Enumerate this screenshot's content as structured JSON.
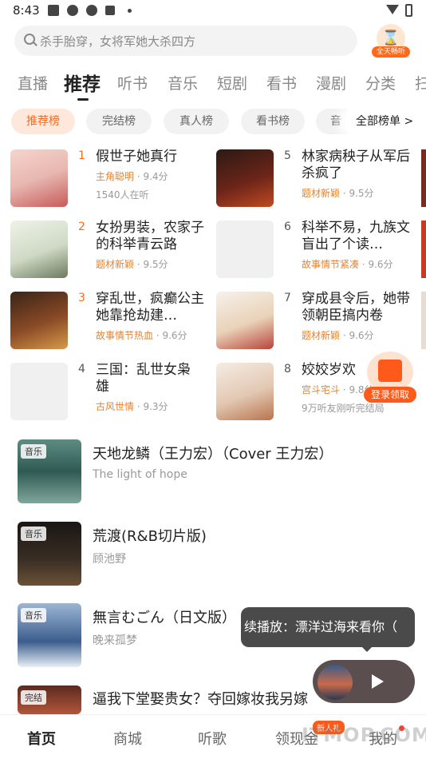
{
  "status_bar": {
    "time": "8:43"
  },
  "search": {
    "placeholder": "杀手胎穿，女将军她大杀四方"
  },
  "promo": {
    "label": "全天畅听"
  },
  "tabs": [
    "直播",
    "推荐",
    "听书",
    "音乐",
    "短剧",
    "看书",
    "漫剧",
    "分类",
    "扫"
  ],
  "active_tab": "推荐",
  "chips": [
    "推荐榜",
    "完结榜",
    "真人榜",
    "看书榜",
    "音"
  ],
  "all_rankings": "全部榜单 >",
  "books": [
    {
      "rank": "1",
      "title": "假世子她真行",
      "tag": "主角聪明",
      "score": "· 9.4分",
      "sub": "1540人在听"
    },
    {
      "rank": "2",
      "title": "女扮男装，农家子的科举青云路",
      "tag": "题材新颖",
      "score": "· 9.5分",
      "sub": ""
    },
    {
      "rank": "3",
      "title": "穿乱世，疯癫公主她靠抢劫建…",
      "tag": "故事情节热血",
      "score": "· 9.6分",
      "sub": ""
    },
    {
      "rank": "4",
      "title": "三国：乱世女枭雄",
      "tag": "古风世情",
      "score": "· 9.3分",
      "sub": ""
    },
    {
      "rank": "5",
      "title": "林家病秧子从军后杀疯了",
      "tag": "题材新颖",
      "score": "· 9.5分",
      "sub": ""
    },
    {
      "rank": "6",
      "title": "科举不易，九族文盲出了个读…",
      "tag": "故事情节紧凑",
      "score": "· 9.6分",
      "sub": ""
    },
    {
      "rank": "7",
      "title": "穿成县令后，她带领朝臣搞内卷",
      "tag": "题材新颖",
      "score": "· 9.6分",
      "sub": ""
    },
    {
      "rank": "8",
      "title": "姣姣岁欢",
      "tag": "宫斗宅斗",
      "score": "· 9.8分",
      "sub": "9万听友刚听完结局"
    }
  ],
  "music": [
    {
      "tag": "音乐",
      "title": "天地龙鳞（王力宏）（Cover 王力宏）",
      "sub": "The light of hope"
    },
    {
      "tag": "音乐",
      "title": "荒渡(R&B切片版)",
      "sub": "顾池野"
    },
    {
      "tag": "音乐",
      "title": "無言むごん（日文版）",
      "sub": "晚来孤梦"
    },
    {
      "tag": "完结",
      "title": "逼我下堂娶贵女？夺回嫁妆我另嫁",
      "sub": ""
    }
  ],
  "login_float": {
    "label": "登录领取"
  },
  "toast": {
    "text": "续播放：漂洋过海来看你（"
  },
  "bottom_nav": [
    "首页",
    "商城",
    "听歌",
    "领现金",
    "我的"
  ],
  "new_badge": "新人礼",
  "watermark": "ITMOP.COM"
}
